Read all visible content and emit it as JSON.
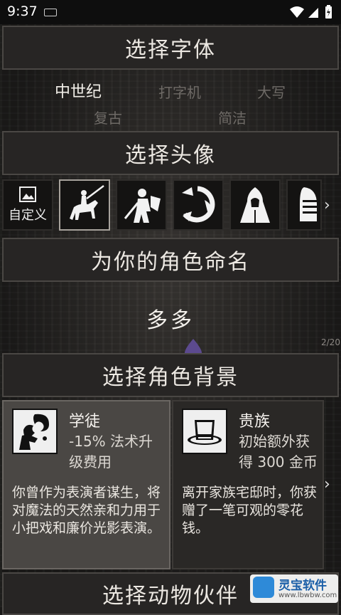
{
  "status_bar": {
    "time": "9:37"
  },
  "font_section": {
    "title": "选择字体",
    "options": [
      "中世纪",
      "打字机",
      "大写",
      "复古",
      "简洁"
    ],
    "selected": "中世纪"
  },
  "avatar_section": {
    "title": "选择头像",
    "custom_label": "自定义",
    "avatars": [
      "knight-on-horse-icon",
      "swordsman-icon",
      "warrior-shield-icon",
      "spinning-blade-icon",
      "hooded-figure-icon",
      "helmet-icon"
    ]
  },
  "name_section": {
    "title": "为你的角色命名",
    "name_value": "多多",
    "page_counter": "2/20"
  },
  "background_section": {
    "title": "选择角色背景",
    "cards": [
      {
        "title": "学徒",
        "bonus_line1": "-15% 法术升",
        "bonus_line2": "级费用",
        "description": "你曾作为表演者谋生，将对魔法的天然亲和力用于小把戏和廉价光影表演。",
        "icon": "magic-hand-icon",
        "selected": true
      },
      {
        "title": "贵族",
        "bonus_line1": "初始额外获",
        "bonus_line2": "得 300 金币",
        "description": "离开家族宅邸时，你获赠了一笔可观的零花钱。",
        "icon": "top-hat-icon",
        "selected": false
      }
    ]
  },
  "companion_section": {
    "title": "选择动物伙伴"
  },
  "watermark": {
    "name": "灵宝软件",
    "url": "www.lbwbw.com"
  },
  "colors": {
    "accent_purple": "#5c4a8f",
    "panel": "#272524"
  }
}
